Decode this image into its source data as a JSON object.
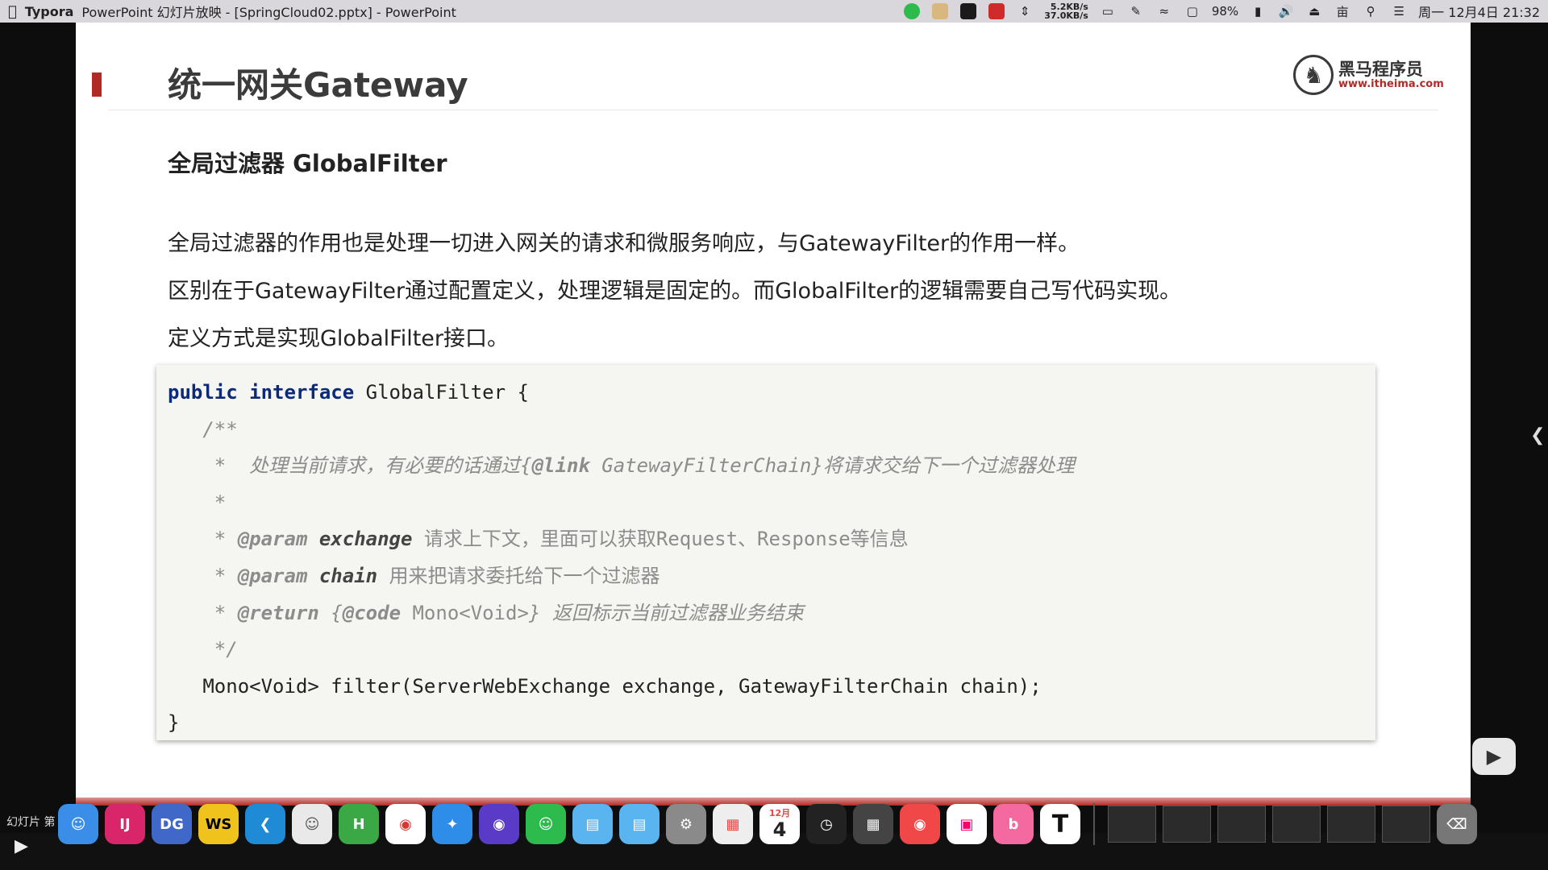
{
  "menubar": {
    "app_name": "Typora",
    "window_title": "PowerPoint 幻灯片放映 - [SpringCloud02.pptx] - PowerPoint",
    "net_up": "5.2KB/s",
    "net_down": "37.0KB/s",
    "battery": "98%",
    "clock": "周一 12月4日 21:32"
  },
  "slide": {
    "title": "统一网关Gateway",
    "logo_name": "黑马程序员",
    "logo_url": "www.itheima.com",
    "subtitle": "全局过滤器 GlobalFilter",
    "paragraphs": [
      "全局过滤器的作用也是处理一切进入网关的请求和微服务响应，与GatewayFilter的作用一样。",
      "区别在于GatewayFilter通过配置定义，处理逻辑是固定的。而GlobalFilter的逻辑需要自己写代码实现。",
      "定义方式是实现GlobalFilter接口。"
    ],
    "code": {
      "kw_public": "public",
      "kw_interface": "interface",
      "decl_rest": " GlobalFilter {",
      "doc_open": "   /**",
      "doc_line1_a": "    *  处理当前请求，有必要的话通过{",
      "doc_line1_link": "@link",
      "doc_line1_b": " GatewayFilterChain}将请求交给下一个过滤器处理",
      "doc_star": "    *",
      "p1_pre": "    * ",
      "p1_tag": "@param",
      "p1_name": " exchange",
      "p1_desc": " 请求上下文，里面可以获取Request、Response等信息",
      "p2_pre": "    * ",
      "p2_tag": "@param",
      "p2_name": " chain",
      "p2_desc": " 用来把请求委托给下一个过滤器",
      "r_pre": "    * ",
      "r_tag": "@return",
      "r_a": " {",
      "r_code": "@code",
      "r_type": " Mono<Void>",
      "r_b": "} 返回标示当前过滤器业务结束",
      "doc_close": "    */",
      "method": "   Mono<Void> filter(ServerWebExchange exchange, GatewayFilterChain chain);",
      "end": "}"
    }
  },
  "bottom": {
    "slide_label": "幻灯片 第"
  },
  "dock": {
    "calendar_month": "12月",
    "calendar_day": "4"
  }
}
